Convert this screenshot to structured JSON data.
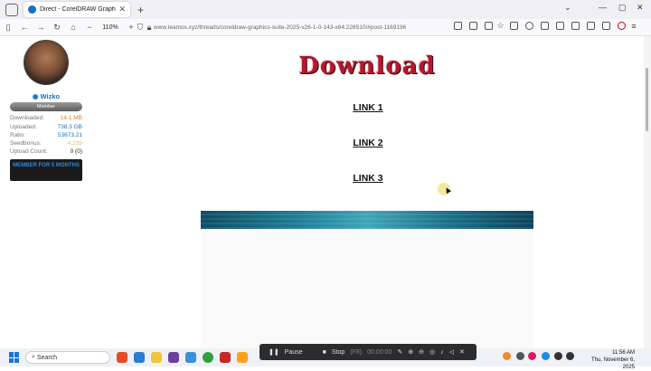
{
  "browser": {
    "tab_title": "Direct - CorelDRAW Graphics S…",
    "tab_close": "✕",
    "new_tab": "+",
    "zoom": "110%",
    "url": "www.teamos.xyz/threads/coreldraw-graphics-suite-2025-v26-1-0-143-x64.226510/#post-1169196",
    "window_controls": [
      "—",
      "▢",
      "✕"
    ]
  },
  "sidebar": {
    "username": "Wizko",
    "role": "Member",
    "stats": {
      "downloaded_label": "Downloaded:",
      "downloaded_value": "14.1 MB",
      "uploaded_label": "Uploaded:",
      "uploaded_value": "738.3 GB",
      "ratio_label": "Ratio:",
      "ratio_value": "53673.21",
      "seedbonus_label": "Seedbonus:",
      "seedbonus_value": "4,239",
      "uploadcount_label": "Upload Count:",
      "uploadcount_value": "0 (0)"
    },
    "member_for": "MEMBER FOR 5 MONTHS"
  },
  "post": {
    "download_title": "Download",
    "links": [
      "LINK 1",
      "LINK 2",
      "LINK 3"
    ]
  },
  "taskbar": {
    "search_placeholder": "Search",
    "time": "11:56 AM",
    "date": "Thu, November 6, 2025"
  },
  "recorder": {
    "pause": "Pause",
    "stop": "Stop",
    "stop_key": "(F8)",
    "timer": "00:00:00"
  },
  "colors": {
    "accent": "#1a6fb5",
    "download_title": "#b3182c",
    "downloaded_value": "#e07a20",
    "seedbonus_value": "#e6b973"
  }
}
